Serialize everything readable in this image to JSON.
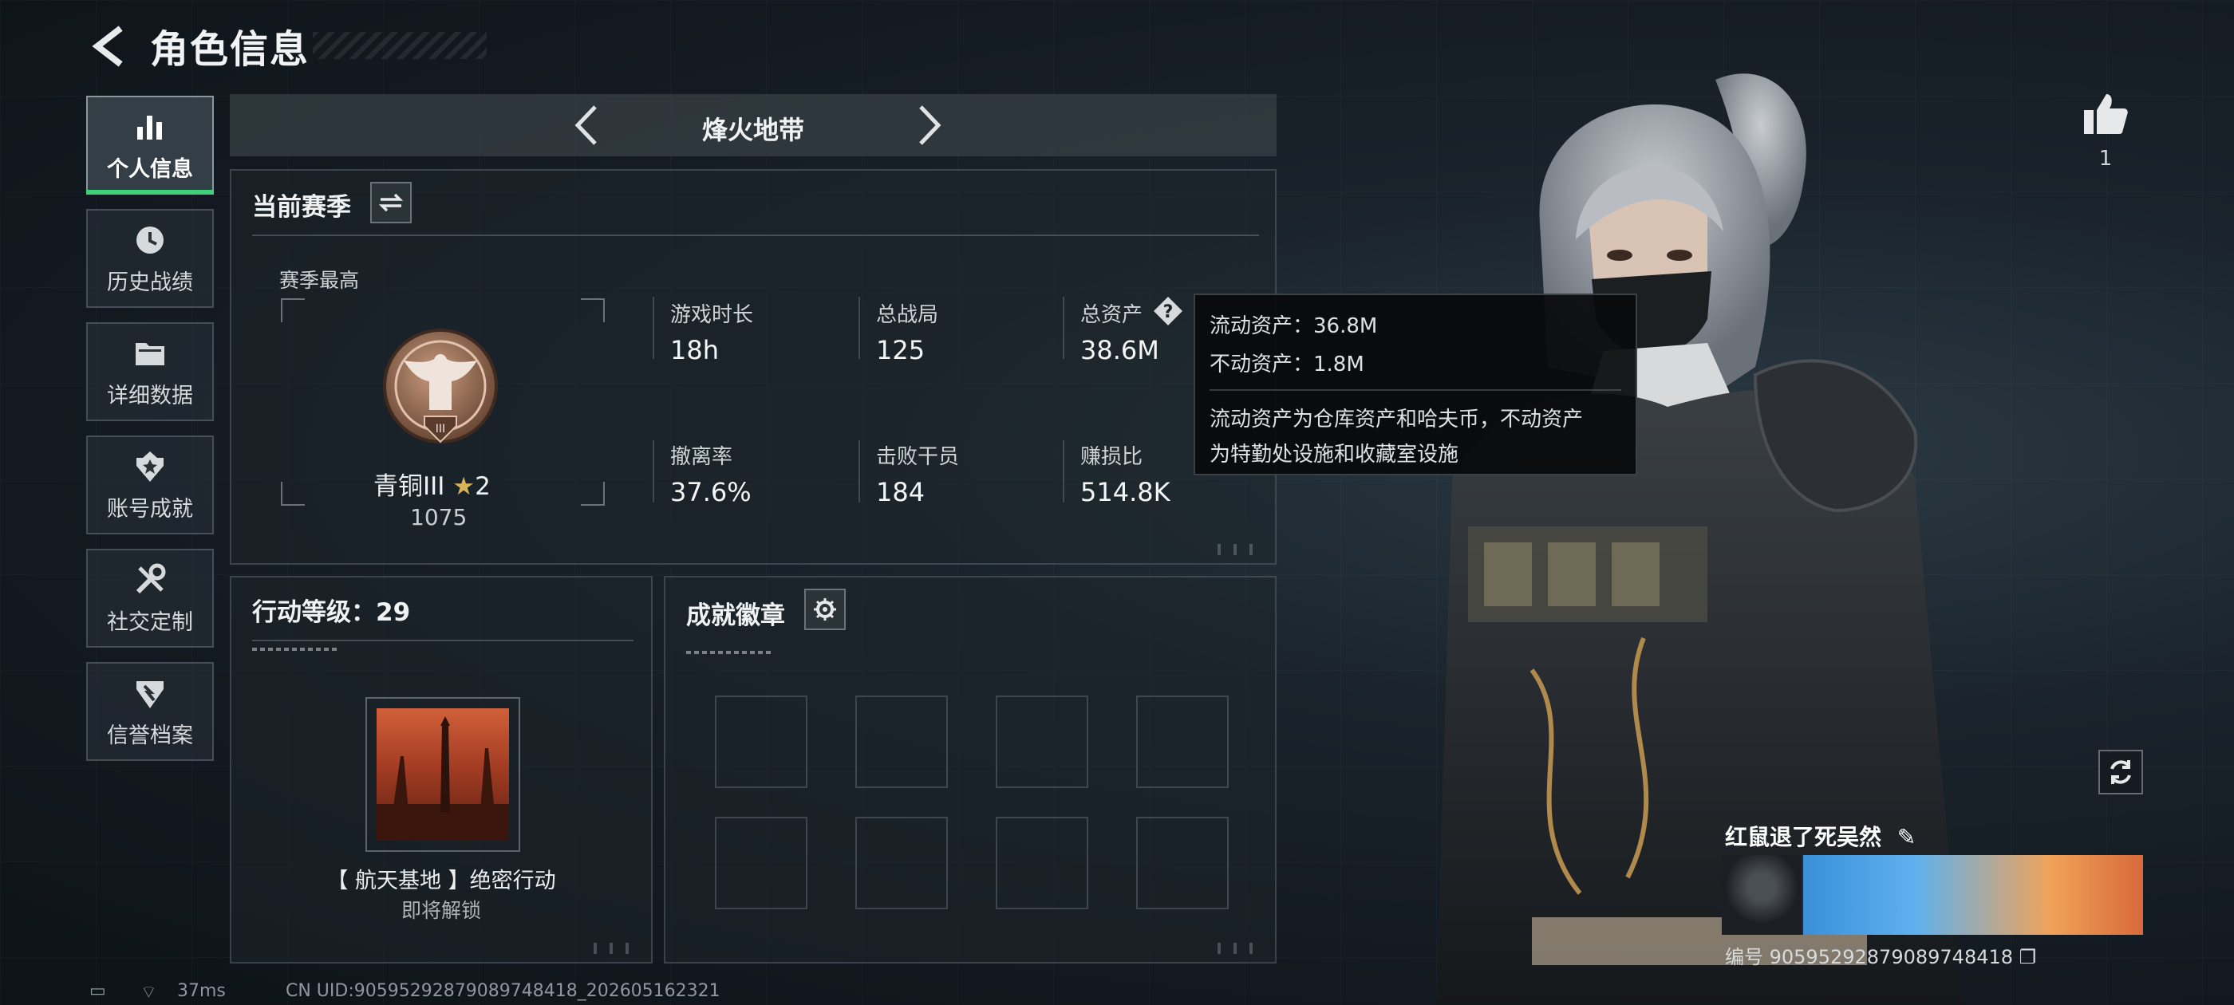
{
  "header": {
    "title": "角色信息"
  },
  "sidebar": {
    "items": [
      {
        "label": "个人信息",
        "icon": "bar-chart-icon",
        "active": true
      },
      {
        "label": "历史战绩",
        "icon": "history-icon"
      },
      {
        "label": "详细数据",
        "icon": "folder-icon"
      },
      {
        "label": "账号成就",
        "icon": "achievement-icon"
      },
      {
        "label": "社交定制",
        "icon": "tools-icon"
      },
      {
        "label": "信誉档案",
        "icon": "credit-icon"
      }
    ]
  },
  "mode": {
    "title": "烽火地带"
  },
  "season": {
    "title": "当前赛季",
    "best_label": "赛季最高",
    "rank_name": "青铜III",
    "rank_stars": "2",
    "rank_score": "1075",
    "stats": [
      {
        "label": "游戏时长",
        "value": "18h"
      },
      {
        "label": "总战局",
        "value": "125"
      },
      {
        "label": "总资产",
        "value": "38.6M"
      },
      {
        "label": "撤离率",
        "value": "37.6%"
      },
      {
        "label": "击败干员",
        "value": "184"
      },
      {
        "label": "赚损比",
        "value": "514.8K"
      }
    ]
  },
  "tooltip": {
    "liquid": "流动资产：36.8M",
    "fixed": "不动资产：1.8M",
    "note_line1": "流动资产为仓库资产和哈夫币，不动资产",
    "note_line2": "为特勤处设施和收藏室设施"
  },
  "action": {
    "title": "行动等级：29",
    "mission_name": "【 航天基地 】绝密行动",
    "mission_status": "即将解锁"
  },
  "badges": {
    "title": "成就徽章"
  },
  "profile": {
    "likes": "1",
    "card_name": "红鼠退了死吴然",
    "card_id": "编号 9059529287908974841​8"
  },
  "status_bar": {
    "ping": "37ms",
    "uid": "CN UID:90595292879089748418_202605162321"
  },
  "colors": {
    "accent": "#3fd07a",
    "background": "#141c22"
  }
}
